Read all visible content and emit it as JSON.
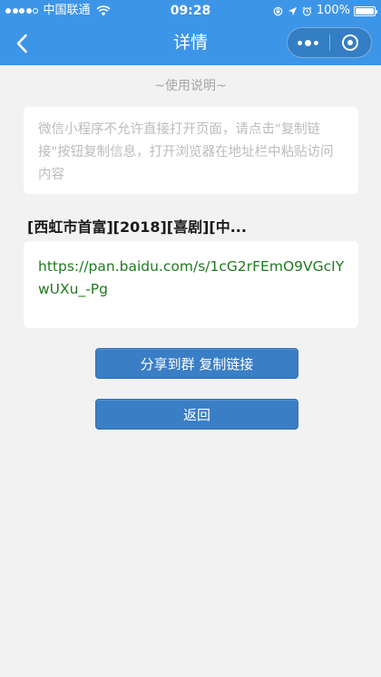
{
  "status_bar": {
    "carrier": "中国联通",
    "time": "09:28",
    "battery": "100%"
  },
  "nav": {
    "title": "详情"
  },
  "section_label": "~使用说明~",
  "instructions": "微信小程序不允许直接打开页面，请点击\"复制链接\"按钮复制信息，打开浏览器在地址栏中粘贴访问内容",
  "resource": {
    "title": "[西虹市首富][2018][喜剧][中...",
    "link": "https://pan.baidu.com/s/1cG2rFEmO9VGcIYwUXu_-Pg"
  },
  "buttons": {
    "copy": "分享到群 复制链接",
    "return": "返回"
  },
  "colors": {
    "header": "#3d95e8",
    "button": "#3a7ec6",
    "link": "#1f7a1f",
    "background": "#f2f2f2"
  }
}
